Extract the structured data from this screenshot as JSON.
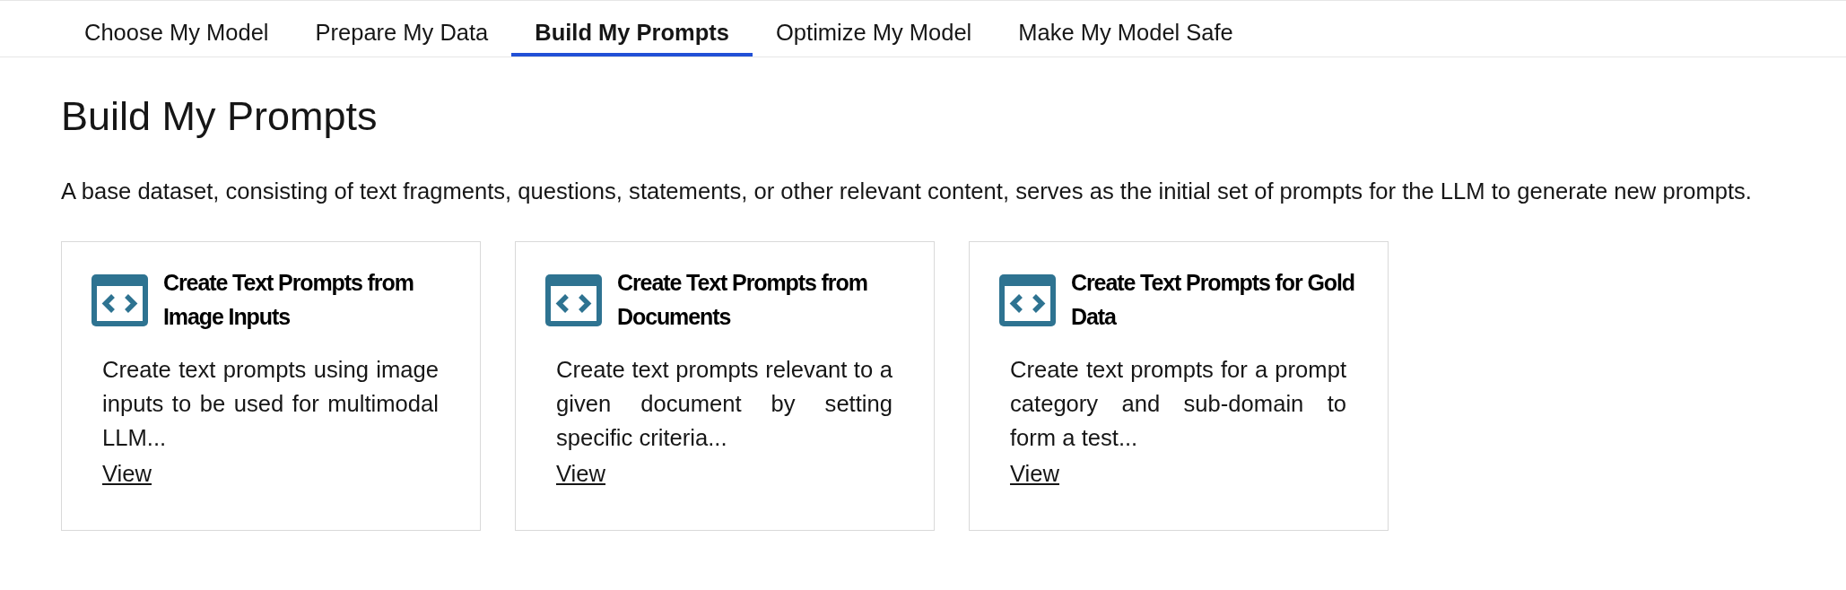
{
  "tabs": [
    {
      "label": "Choose My Model",
      "selected": false
    },
    {
      "label": "Prepare My Data",
      "selected": false
    },
    {
      "label": "Build My Prompts",
      "selected": true
    },
    {
      "label": "Optimize My Model",
      "selected": false
    },
    {
      "label": "Make My Model Safe",
      "selected": false
    }
  ],
  "page": {
    "title": "Build My Prompts",
    "description": "A base dataset, consisting of text fragments, questions, statements, or other relevant content, serves as the initial set of prompts for the LLM to generate new prompts."
  },
  "cards": [
    {
      "title": "Create Text Prompts from Image Inputs",
      "description": "Create text prompts using image inputs to be used for multimodal LLM...",
      "link": "View"
    },
    {
      "title": "Create Text Prompts from Documents",
      "description": "Create text prompts relevant to a given document by setting specific criteria...",
      "link": "View"
    },
    {
      "title": "Create Text Prompts for Gold Data",
      "description": "Create text prompts for a prompt category and sub-domain to form a test...",
      "link": "View"
    }
  ]
}
